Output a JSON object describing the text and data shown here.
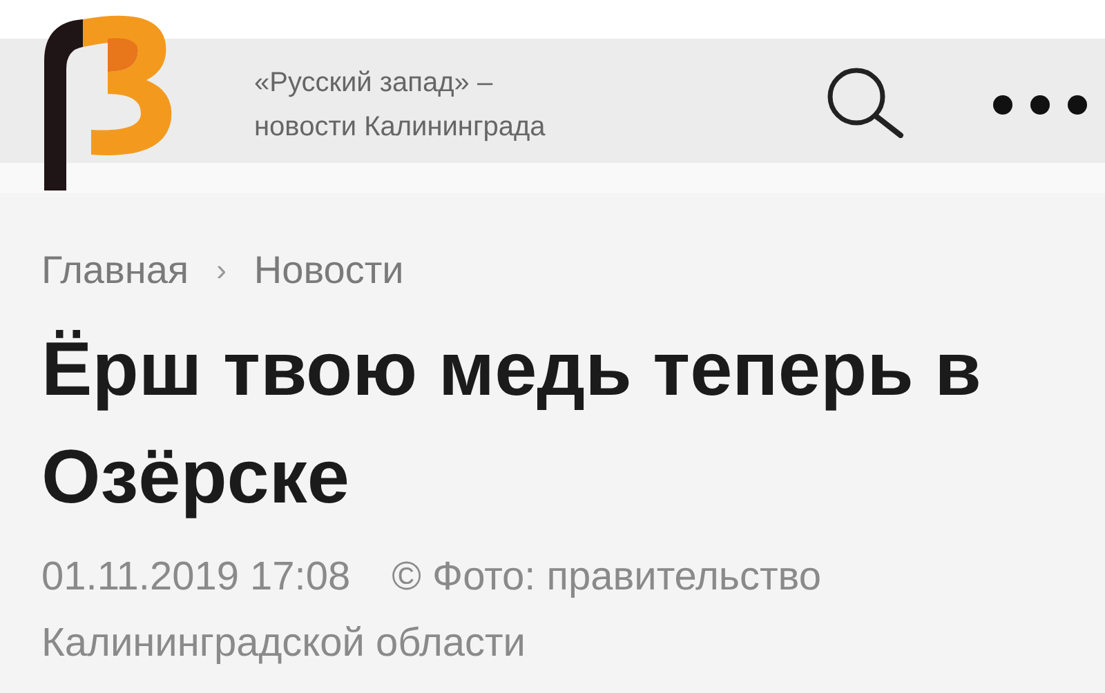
{
  "header": {
    "tagline_1": "«Русский запад» –",
    "tagline_2": "новости Калининграда"
  },
  "breadcrumbs": [
    {
      "label": "Главная"
    },
    {
      "label": "Новости"
    }
  ],
  "breadcrumb_separator": "›",
  "article": {
    "title": "Ёрш твою медь теперь в Озёрске",
    "date": "01.11.2019 17:08",
    "photo_credit": "© Фото: правительство Калининградской области"
  }
}
